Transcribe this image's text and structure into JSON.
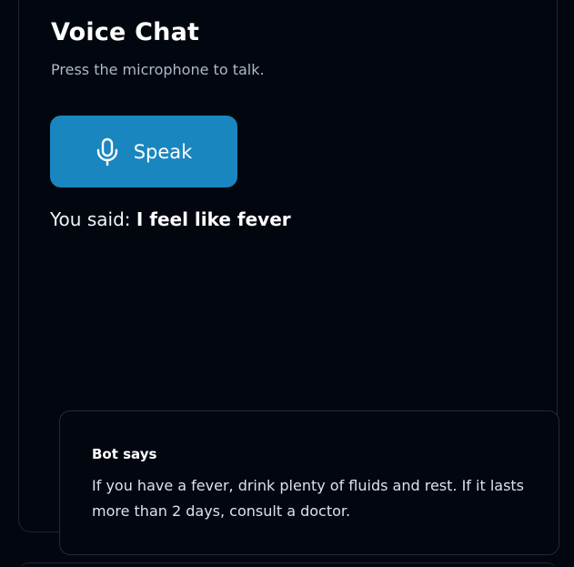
{
  "voice_chat": {
    "title": "Voice Chat",
    "subtitle": "Press the microphone to talk.",
    "speak_button": {
      "label": "Speak",
      "icon": "microphone-icon",
      "color": "#1a86c0"
    },
    "transcript": {
      "prefix": "You said:",
      "text": "I feel like fever"
    }
  },
  "bot": {
    "heading": "Bot says",
    "message": "If you have a fever, drink plenty of fluids and rest. If it lasts more than 2 days, consult a doctor."
  },
  "colors": {
    "background": "#02060f",
    "accent": "#1a86c0",
    "border": "#1f2633"
  }
}
